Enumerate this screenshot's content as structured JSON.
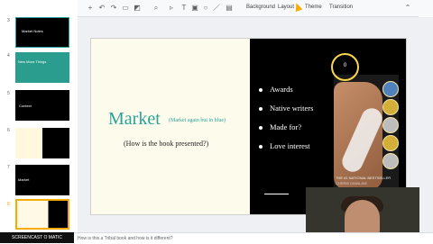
{
  "toolbar": {
    "background": "Background",
    "layout": "Layout",
    "theme": "Theme",
    "transition": "Transition"
  },
  "slides": [
    {
      "number": "3",
      "label": "Market Notes"
    },
    {
      "number": "4",
      "label": "New Mora Things"
    },
    {
      "number": "5",
      "label": "Context"
    },
    {
      "number": "6",
      "label": ""
    },
    {
      "number": "7",
      "label": "Market"
    },
    {
      "number": "8",
      "label": ""
    }
  ],
  "slide": {
    "title": "Market",
    "subtitle": "(Market again but in blue)",
    "question": "(How is the book presented?)",
    "bullets": [
      "Awards",
      "Native writers",
      "Made for?",
      "Love interest"
    ],
    "cover_tagline": "THE #1 NATIONAL BESTSELLER",
    "cover_author": "CHERIE DIMALINE",
    "cover_title": "THE MARROW THIEVES"
  },
  "click_ring": "0",
  "footer": {
    "watermark": "SCREENCAST O MATIC",
    "notes": "How is this a Tribal book and how is it different?"
  },
  "colors": {
    "accent": "#2aa39a",
    "highlight": "#f9d74c"
  }
}
